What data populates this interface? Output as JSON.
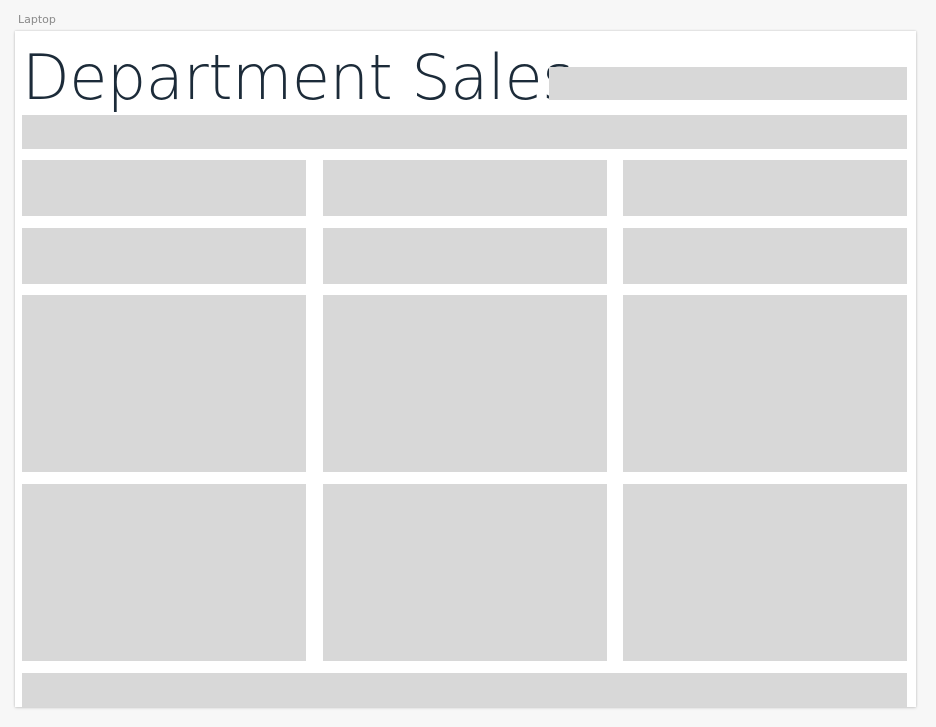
{
  "frame": {
    "label": "Laptop"
  },
  "page": {
    "title": "Department Sales"
  },
  "colors": {
    "title_text": "#1c2b39",
    "placeholder": "#d8d8d8",
    "canvas": "#f7f7f7",
    "artboard": "#ffffff"
  }
}
